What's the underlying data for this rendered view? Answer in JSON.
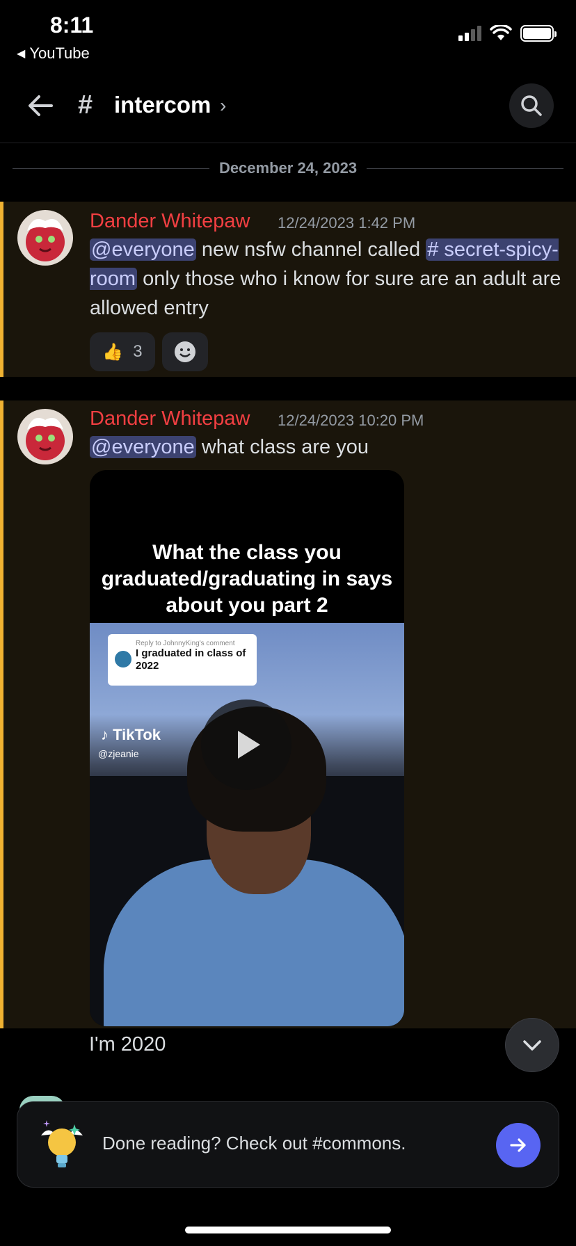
{
  "status_bar": {
    "time": "8:11",
    "back_app": "YouTube"
  },
  "header": {
    "channel_name": "intercom"
  },
  "date_divider": "December 24, 2023",
  "messages": [
    {
      "author": "Dander Whitepaw",
      "timestamp": "12/24/2023 1:42 PM",
      "mention": "@everyone",
      "text_1": "new nsfw channel called",
      "channel_mention": "# secret-spicy-room",
      "text_2": "only those who i know for sure are an adult are allowed entry",
      "reactions": [
        {
          "emoji": "👍",
          "count": "3"
        }
      ]
    },
    {
      "author": "Dander Whitepaw",
      "timestamp": "12/24/2023 10:20 PM",
      "mention": "@everyone",
      "text": "what class are you",
      "video": {
        "caption": "What the class you graduated/graduating in says about you part 2",
        "reply_label": "Reply to JohnnyKing's comment",
        "reply_text": "I graduated in class of 2022",
        "watermark": "TikTok",
        "handle": "@zjeanie"
      }
    }
  ],
  "reply_preview": "I'm 2020",
  "banner": {
    "text": "Done reading? Check out #commons."
  },
  "colors": {
    "accent": "#5865f2",
    "author": "#f23f42",
    "highlight": "#f0b232"
  }
}
